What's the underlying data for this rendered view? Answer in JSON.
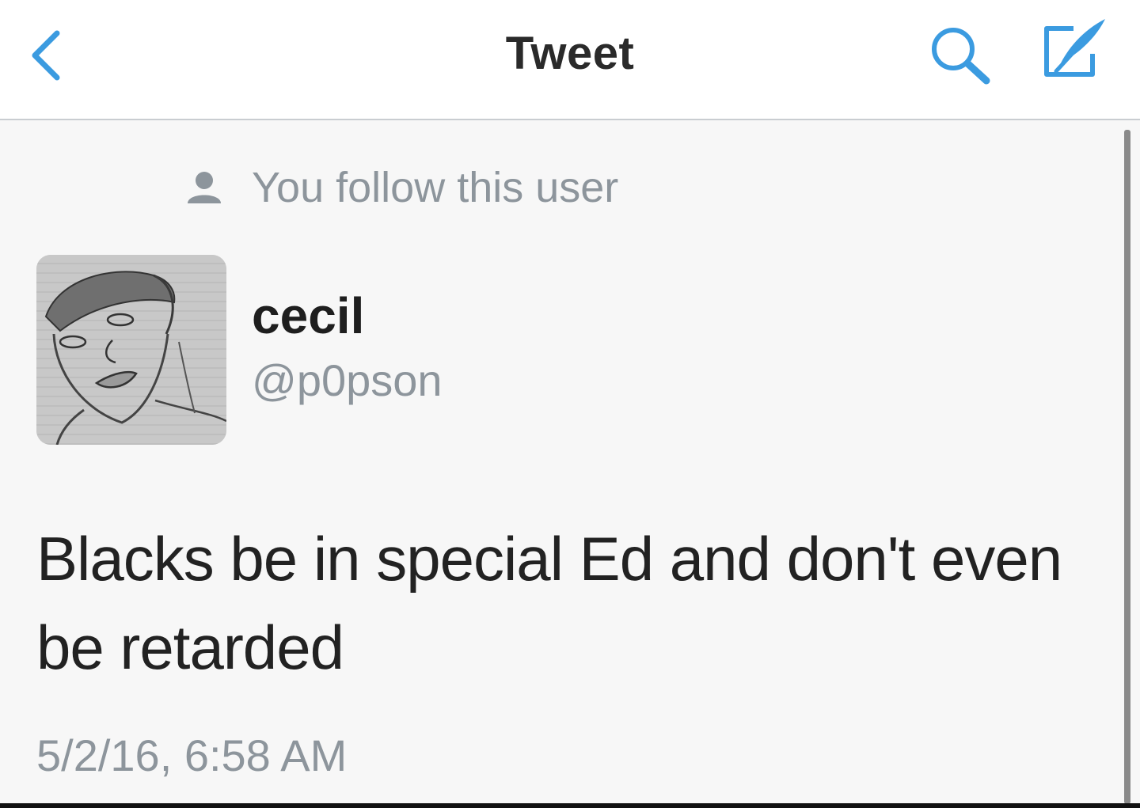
{
  "header": {
    "title": "Tweet",
    "back_icon": "chevron-left-icon",
    "search_icon": "search-icon",
    "compose_icon": "compose-icon",
    "accent_color": "#3b9be0"
  },
  "follow_status": {
    "icon": "person-icon",
    "text": "You follow this user"
  },
  "user": {
    "name": "cecil",
    "handle": "@p0pson",
    "avatar": "sketched-face-avatar"
  },
  "tweet": {
    "text": "Blacks be in special Ed and don't even be retarded",
    "timestamp": "5/2/16, 6:58 AM"
  }
}
